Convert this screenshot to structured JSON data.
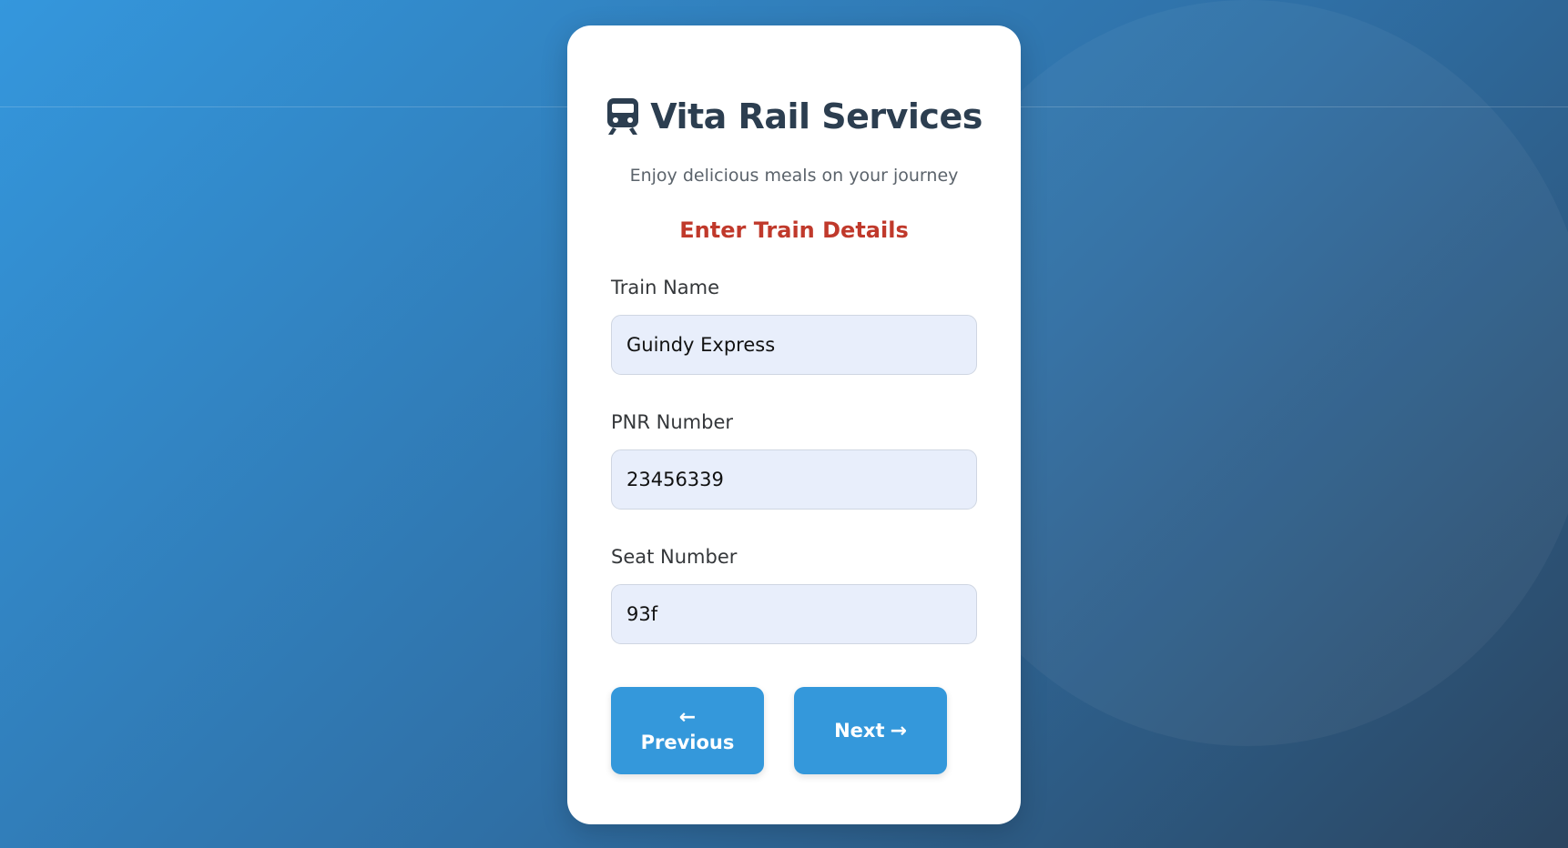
{
  "brand": {
    "title": "Vita Rail Services",
    "icon": "train-icon",
    "subtitle": "Enjoy delicious meals on your journey"
  },
  "form": {
    "section_title": "Enter Train Details",
    "fields": [
      {
        "label": "Train Name",
        "value": "Guindy Express"
      },
      {
        "label": "PNR Number",
        "value": "23456339"
      },
      {
        "label": "Seat Number",
        "value": "93f"
      }
    ]
  },
  "buttons": {
    "previous": {
      "arrow": "←",
      "label": "Previous"
    },
    "next": {
      "label": "Next",
      "arrow": "→"
    }
  },
  "colors": {
    "accent": "#3498db",
    "section_title": "#c0392b",
    "heading": "#2c3e50",
    "input_bg": "#e8eefb"
  }
}
